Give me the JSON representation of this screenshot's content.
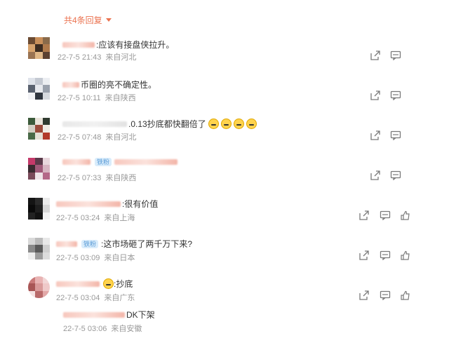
{
  "header": {
    "reply_count_label": "共4条回复"
  },
  "comments": [
    {
      "text": ":应该有接盘侠拉升。",
      "date": "22-7-5 21:43",
      "location": "来自河北"
    },
    {
      "text": "币圈的亮不确定性。",
      "date": "22-7-5 10:11",
      "location": "来自陕西"
    },
    {
      "text": ".0.13抄底都快翻倍了",
      "date": "22-7-5 07:48",
      "location": "来自河北"
    },
    {
      "text": "",
      "badge": "铁粉",
      "date": "22-7-5 07:33",
      "location": "来自陕西"
    },
    {
      "text": ":很有价值",
      "date": "22-7-5 03:24",
      "location": "来自上海"
    },
    {
      "text": ":这市场砸了两千万下来?",
      "badge": "铁粉",
      "date": "22-7-5 03:09",
      "location": "来自日本"
    },
    {
      "text": ":抄底",
      "date": "22-7-5 03:04",
      "location": "来自广东"
    }
  ],
  "sub_reply": {
    "text": "DK下架",
    "date": "22-7-5 03:06",
    "location": "来自安徽"
  },
  "icons": [
    "share-icon",
    "comment-icon",
    "like-icon"
  ],
  "colors": {
    "accent": "#eb7350",
    "meta": "#999999",
    "badge_bg": "#d9ecfb"
  }
}
